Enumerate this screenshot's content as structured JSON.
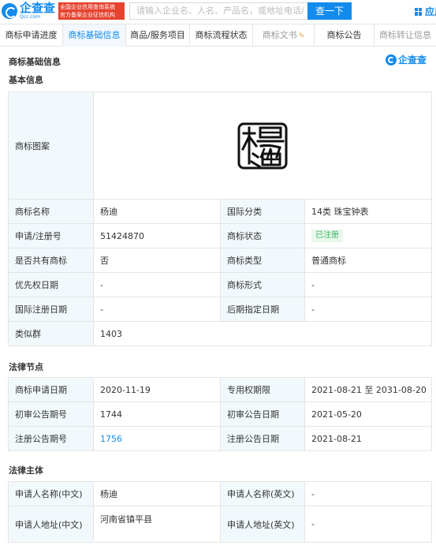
{
  "header": {
    "logo_name": "企查查",
    "logo_domain": "Qcc.com",
    "badge_line1": "全国企业信用查询系统",
    "badge_line2": "官方备案企业征信机构",
    "search_placeholder": "请输入企业名、人名、产品名，或地址电话/",
    "search_button": "查一下",
    "app_link": "应用"
  },
  "tabs": [
    {
      "label": "商标申请进度"
    },
    {
      "label": "商标基础信息"
    },
    {
      "label": "商品/服务项目"
    },
    {
      "label": "商标流程状态"
    },
    {
      "label": "商标文书"
    },
    {
      "label": "商标公告"
    },
    {
      "label": "商标转让信息"
    }
  ],
  "page": {
    "title": "商标基础信息",
    "brand": "企查查"
  },
  "basic": {
    "title": "基本信息",
    "image_label": "商标图案",
    "rows": [
      {
        "l1": "商标名称",
        "v1": "杨迪",
        "l2": "国际分类",
        "v2": "14类 珠宝钟表"
      },
      {
        "l1": "申请/注册号",
        "v1": "51424870",
        "l2": "商标状态",
        "v2": "已注册"
      },
      {
        "l1": "是否共有商标",
        "v1": "否",
        "l2": "商标类型",
        "v2": "普通商标"
      },
      {
        "l1": "优先权日期",
        "v1": "-",
        "l2": "商标形式",
        "v2": "-"
      },
      {
        "l1": "国际注册日期",
        "v1": "-",
        "l2": "后期指定日期",
        "v2": "-"
      },
      {
        "l1": "类似群",
        "v1": "1403"
      }
    ]
  },
  "legal_nodes": {
    "title": "法律节点",
    "rows": [
      {
        "l1": "商标申请日期",
        "v1": "2020-11-19",
        "l2": "专用权期限",
        "v2": "2021-08-21 至 2031-08-20"
      },
      {
        "l1": "初审公告期号",
        "v1": "1744",
        "l2": "初审公告日期",
        "v2": "2021-05-20"
      },
      {
        "l1": "注册公告期号",
        "v1": "1756",
        "l2": "注册公告日期",
        "v2": "2021-08-21"
      }
    ]
  },
  "legal_subject": {
    "title": "法律主体",
    "rows": [
      {
        "l1": "申请人名称(中文)",
        "v1": "杨迪",
        "l2": "申请人名称(英文)",
        "v2": "-"
      },
      {
        "l1": "申请人地址(中文)",
        "v1": "河南省镇平县",
        "l2": "申请人地址(英文)",
        "v2": "-"
      }
    ]
  },
  "colors": {
    "accent": "#128bed",
    "label_bg": "#f2f9fc",
    "status_green": "#3cb55e"
  }
}
